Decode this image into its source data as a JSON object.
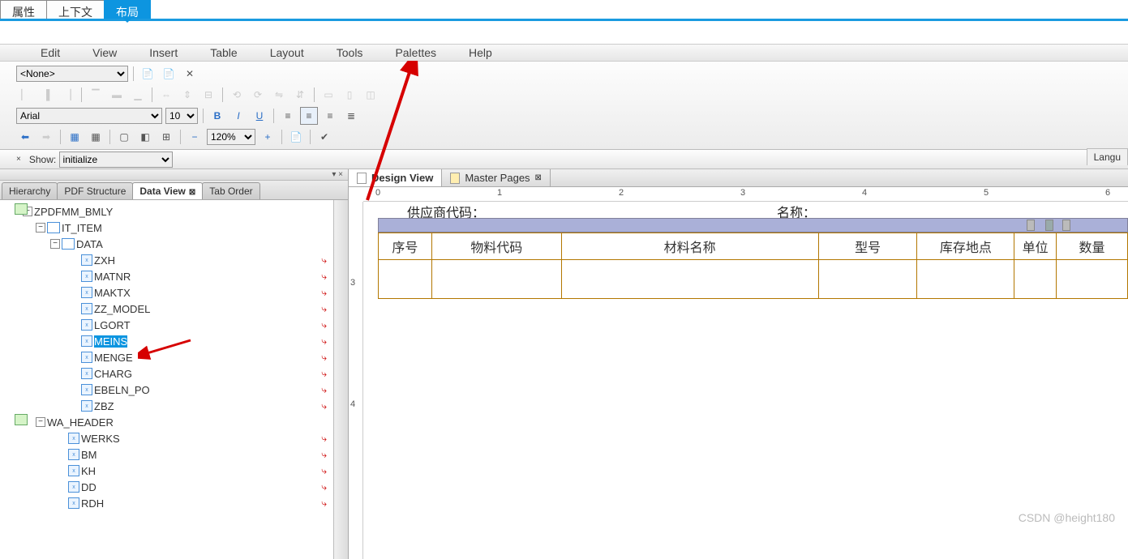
{
  "top_tabs": {
    "attr": "属性",
    "ctx": "上下文",
    "layout": "布局"
  },
  "menu": {
    "edit": "Edit",
    "view": "View",
    "insert": "Insert",
    "table": "Table",
    "layout": "Layout",
    "tools": "Tools",
    "palettes": "Palettes",
    "help": "Help"
  },
  "toolbar": {
    "filter_value": "<None>",
    "font": "Arial",
    "size": "10",
    "zoom": "120%",
    "show_label": "Show:",
    "show_value": "initialize"
  },
  "lang_tab": "Langu",
  "left_tabs": {
    "hierarchy": "Hierarchy",
    "pdf": "PDF Structure",
    "data": "Data View",
    "tab": "Tab Order"
  },
  "tree": {
    "root": "ZPDFMM_BMLY",
    "it_item": "IT_ITEM",
    "data": "DATA",
    "fields": [
      "ZXH",
      "MATNR",
      "MAKTX",
      "ZZ_MODEL",
      "LGORT",
      "MEINS",
      "MENGE",
      "CHARG",
      "EBELN_PO",
      "ZBZ"
    ],
    "wa_header": "WA_HEADER",
    "wa_fields": [
      "WERKS",
      "BM",
      "KH",
      "DD",
      "RDH"
    ]
  },
  "doc_tabs": {
    "design": "Design View",
    "master": "Master Pages"
  },
  "ruler_nums": [
    "0",
    "1",
    "2",
    "3",
    "4",
    "5",
    "6"
  ],
  "v_ruler": [
    "3",
    "4"
  ],
  "labels": {
    "supplier": "供应商代码：",
    "name": "名称："
  },
  "table_headers": [
    "序号",
    "物料代码",
    "材料名称",
    "型号",
    "库存地点",
    "单位",
    "数量"
  ],
  "watermark": "CSDN @height180"
}
